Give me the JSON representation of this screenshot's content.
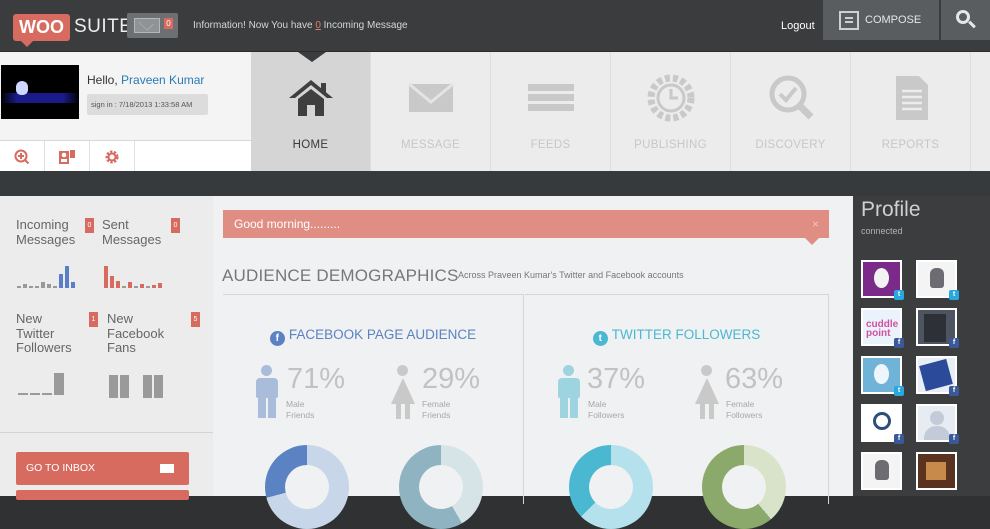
{
  "header": {
    "logo_woo": "WOO",
    "logo_suite": "SUITE",
    "mail_count": "0",
    "info_prefix": "Information! Now You have",
    "info_count": "0",
    "info_suffix": "Incoming Message",
    "logout": "Logout",
    "compose": "COMPOSE"
  },
  "user": {
    "hello": "Hello,",
    "name": "Praveen Kumar",
    "signin": "sign in : 7/18/2013 1:33:58 AM"
  },
  "nav": [
    {
      "label": "HOME",
      "icon": "home-icon"
    },
    {
      "label": "MESSAGE",
      "icon": "envelope-icon"
    },
    {
      "label": "FEEDS",
      "icon": "feeds-icon"
    },
    {
      "label": "PUBLISHING",
      "icon": "clock-gear-icon"
    },
    {
      "label": "DISCOVERY",
      "icon": "magnifier-check-icon"
    },
    {
      "label": "REPORTS",
      "icon": "document-icon"
    }
  ],
  "stats": {
    "incoming": {
      "label1": "Incoming",
      "label2": "Messages",
      "count": "0"
    },
    "sent": {
      "label1": "Sent",
      "label2": "Messages",
      "count": "0"
    },
    "twitter": {
      "label1": "New",
      "label2": "Twitter",
      "label3": "Followers",
      "count": "1"
    },
    "facebook": {
      "label1": "New",
      "label2": "Facebook",
      "label3": "Fans",
      "count": "5"
    }
  },
  "actions": {
    "inbox": "GO TO INBOX"
  },
  "alert": {
    "text": "Good morning.........",
    "close": "×"
  },
  "demographics": {
    "title": "AUDIENCE DEMOGRAPHICS",
    "subtitle": "Across Praveen Kumar's Twitter and Facebook accounts",
    "facebook": {
      "title": "FACEBOOK PAGE AUDIENCE",
      "icon_letter": "f",
      "male_pct": "71%",
      "male_l1": "Male",
      "male_l2": "Friends",
      "female_pct": "29%",
      "female_l1": "Female",
      "female_l2": "Friends",
      "color": "#5b82c2"
    },
    "twitter": {
      "title": "TWITTER FOLLOWERS",
      "icon_letter": "t",
      "male_pct": "37%",
      "male_l1": "Male",
      "male_l2": "Followers",
      "female_pct": "63%",
      "female_l1": "Female",
      "female_l2": "Followers",
      "color": "#4ab8d1"
    }
  },
  "profile": {
    "title": "Profile",
    "subtitle": "connected"
  }
}
